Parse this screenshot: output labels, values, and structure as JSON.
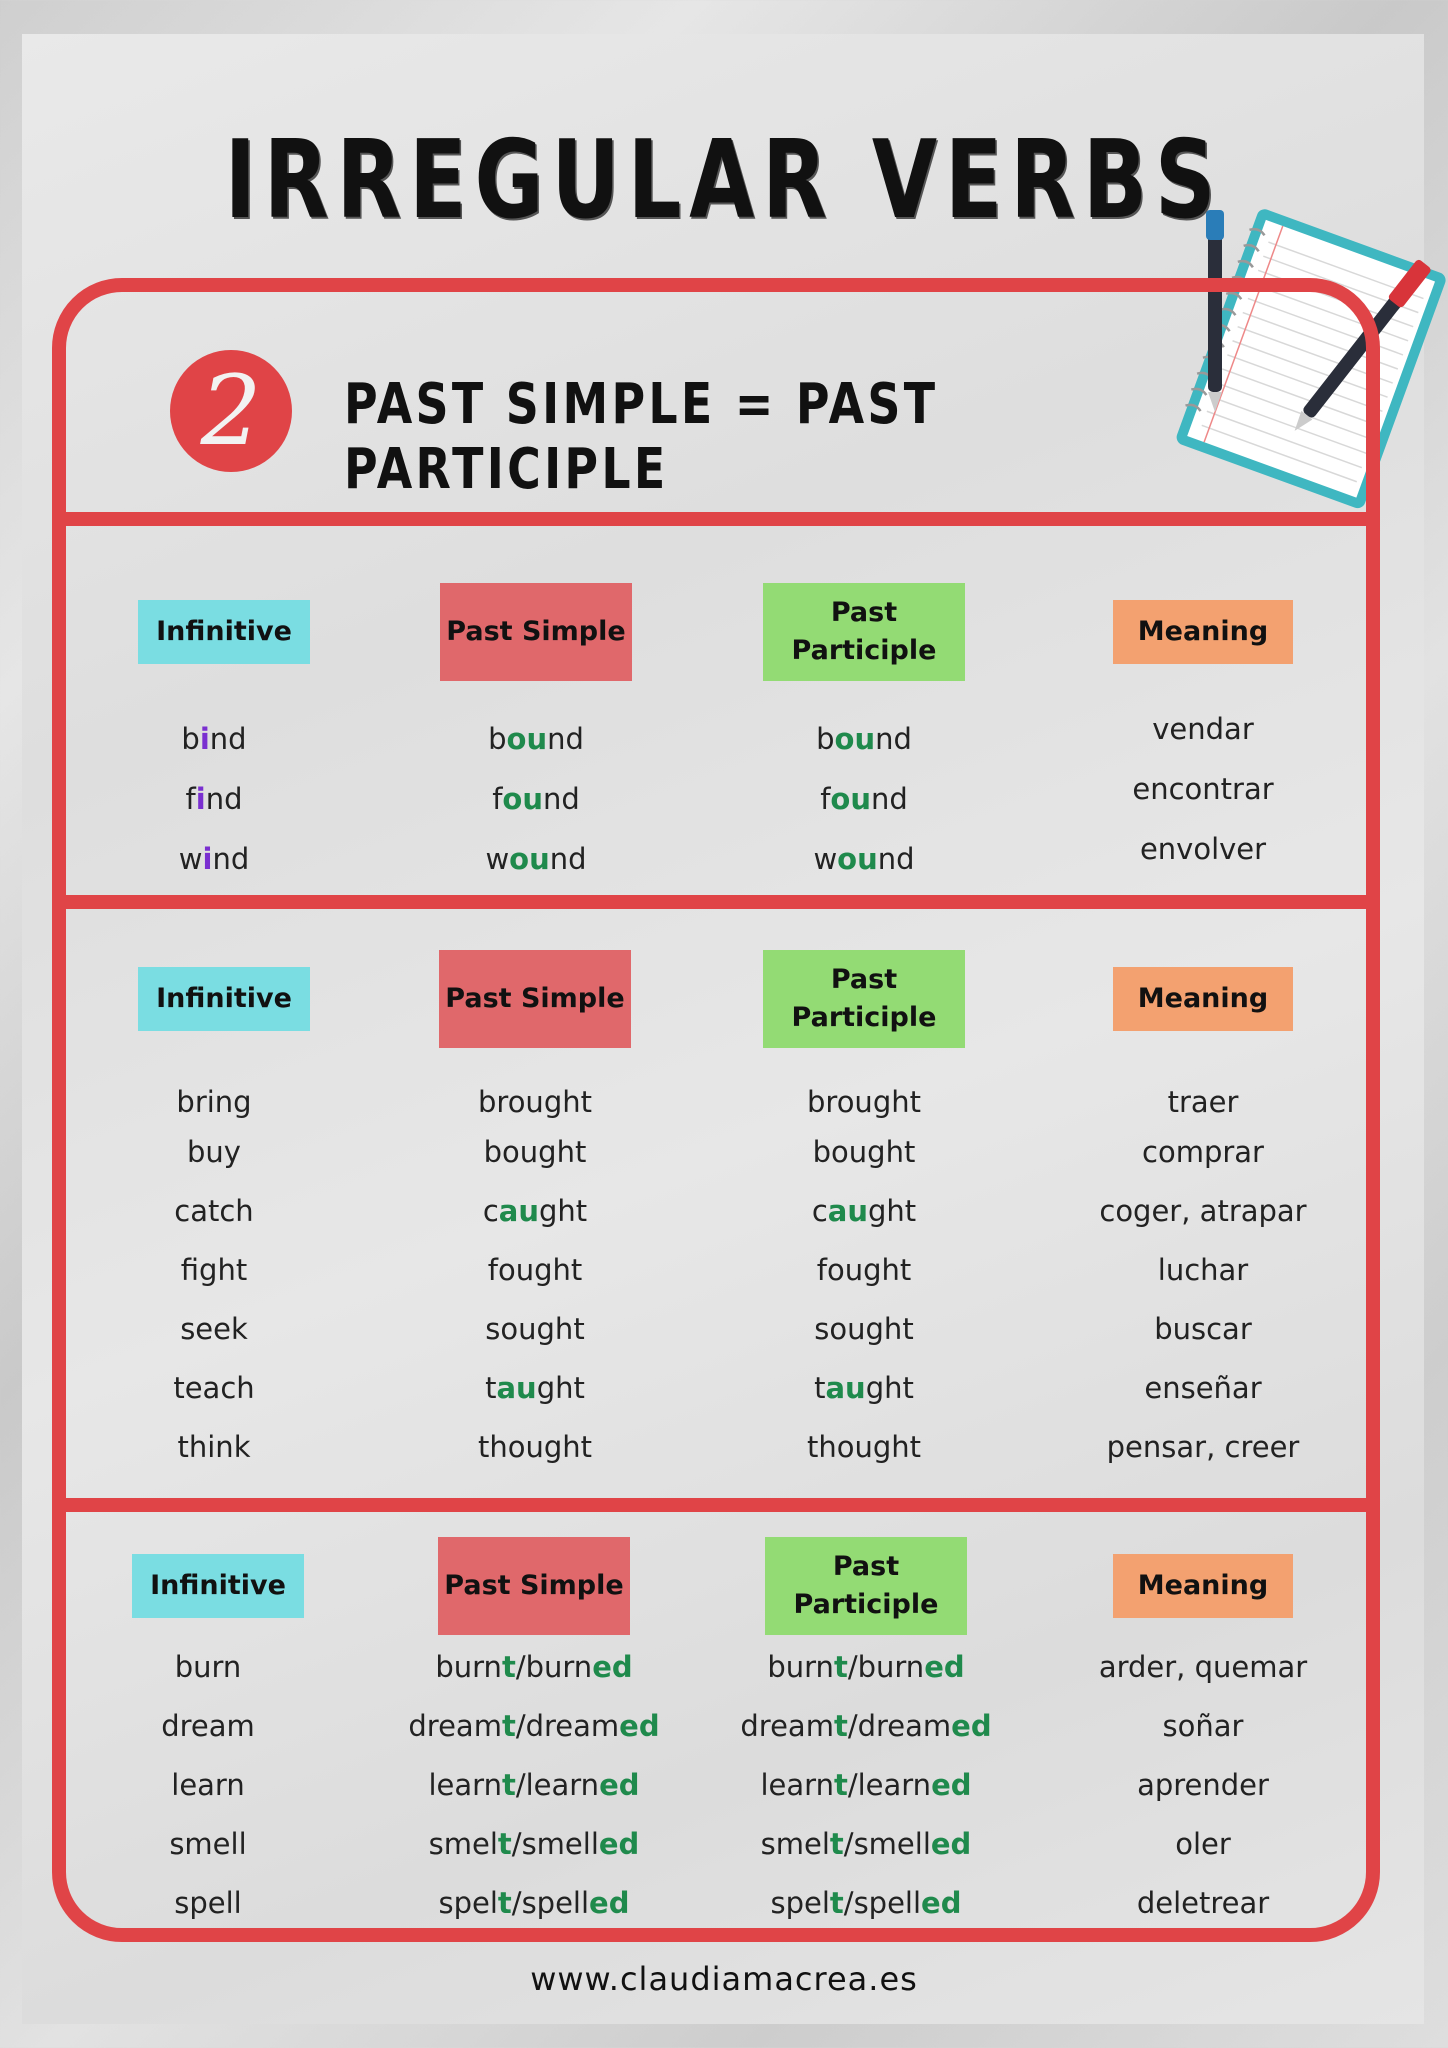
{
  "title": "IRREGULAR VERBS",
  "group": {
    "number": "2",
    "heading": "PAST SIMPLE = PAST PARTICIPLE"
  },
  "colors": {
    "frame": "#e04447",
    "infinitive_header": "#7adde2",
    "past_simple_header": "#e0686b",
    "past_participle_header": "#93db74",
    "meaning_header": "#f3a170",
    "highlight_green": "#1f8a4c",
    "highlight_purple": "#7a2fd0"
  },
  "headers": {
    "infinitive": "Infinitive",
    "past_simple": "Past Simple",
    "past_participle": "Past Participle",
    "meaning": "Meaning"
  },
  "sections": [
    {
      "rows": [
        {
          "infinitive": [
            [
              "b",
              ""
            ],
            [
              "i",
              "p"
            ],
            [
              "nd",
              ""
            ]
          ],
          "past_simple": [
            [
              "b",
              ""
            ],
            [
              "ou",
              "g"
            ],
            [
              "nd",
              ""
            ]
          ],
          "past_participle": [
            [
              "b",
              ""
            ],
            [
              "ou",
              "g"
            ],
            [
              "nd",
              ""
            ]
          ],
          "meaning": "vendar"
        },
        {
          "infinitive": [
            [
              "f",
              ""
            ],
            [
              "i",
              "p"
            ],
            [
              "nd",
              ""
            ]
          ],
          "past_simple": [
            [
              "f",
              ""
            ],
            [
              "ou",
              "g"
            ],
            [
              "nd",
              ""
            ]
          ],
          "past_participle": [
            [
              "f",
              ""
            ],
            [
              "ou",
              "g"
            ],
            [
              "nd",
              ""
            ]
          ],
          "meaning": "encontrar"
        },
        {
          "infinitive": [
            [
              "w",
              ""
            ],
            [
              "i",
              "p"
            ],
            [
              "nd",
              ""
            ]
          ],
          "past_simple": [
            [
              "w",
              ""
            ],
            [
              "ou",
              "g"
            ],
            [
              "nd",
              ""
            ]
          ],
          "past_participle": [
            [
              "w",
              ""
            ],
            [
              "ou",
              "g"
            ],
            [
              "nd",
              ""
            ]
          ],
          "meaning": "envolver"
        }
      ]
    },
    {
      "rows": [
        {
          "infinitive": [
            [
              "bring",
              ""
            ]
          ],
          "past_simple": [
            [
              "brought",
              ""
            ]
          ],
          "past_participle": [
            [
              "brought",
              ""
            ]
          ],
          "meaning": "traer"
        },
        {
          "infinitive": [
            [
              "buy",
              ""
            ]
          ],
          "past_simple": [
            [
              "bought",
              ""
            ]
          ],
          "past_participle": [
            [
              "bought",
              ""
            ]
          ],
          "meaning": "comprar"
        },
        {
          "infinitive": [
            [
              "catch",
              ""
            ]
          ],
          "past_simple": [
            [
              "c",
              ""
            ],
            [
              "au",
              "g"
            ],
            [
              "ght",
              ""
            ]
          ],
          "past_participle": [
            [
              "c",
              ""
            ],
            [
              "au",
              "g"
            ],
            [
              "ght",
              ""
            ]
          ],
          "meaning": "coger, atrapar"
        },
        {
          "infinitive": [
            [
              "fight",
              ""
            ]
          ],
          "past_simple": [
            [
              "fought",
              ""
            ]
          ],
          "past_participle": [
            [
              "fought",
              ""
            ]
          ],
          "meaning": "luchar"
        },
        {
          "infinitive": [
            [
              "seek",
              ""
            ]
          ],
          "past_simple": [
            [
              "sought",
              ""
            ]
          ],
          "past_participle": [
            [
              "sought",
              ""
            ]
          ],
          "meaning": "buscar"
        },
        {
          "infinitive": [
            [
              "teach",
              ""
            ]
          ],
          "past_simple": [
            [
              "t",
              ""
            ],
            [
              "au",
              "g"
            ],
            [
              "ght",
              ""
            ]
          ],
          "past_participle": [
            [
              "t",
              ""
            ],
            [
              "au",
              "g"
            ],
            [
              "ght",
              ""
            ]
          ],
          "meaning": "enseñar"
        },
        {
          "infinitive": [
            [
              "think",
              ""
            ]
          ],
          "past_simple": [
            [
              "thought",
              ""
            ]
          ],
          "past_participle": [
            [
              "thought",
              ""
            ]
          ],
          "meaning": "pensar, creer"
        }
      ]
    },
    {
      "rows": [
        {
          "infinitive": [
            [
              "burn",
              ""
            ]
          ],
          "past_simple": [
            [
              "burn",
              ""
            ],
            [
              "t",
              "g"
            ],
            [
              "/burn",
              ""
            ],
            [
              "ed",
              "g"
            ]
          ],
          "past_participle": [
            [
              "burn",
              ""
            ],
            [
              "t",
              "g"
            ],
            [
              "/burn",
              ""
            ],
            [
              "ed",
              "g"
            ]
          ],
          "meaning": "arder, quemar"
        },
        {
          "infinitive": [
            [
              "dream",
              ""
            ]
          ],
          "past_simple": [
            [
              "dream",
              ""
            ],
            [
              "t",
              "g"
            ],
            [
              "/dream",
              ""
            ],
            [
              "ed",
              "g"
            ]
          ],
          "past_participle": [
            [
              "dream",
              ""
            ],
            [
              "t",
              "g"
            ],
            [
              "/dream",
              ""
            ],
            [
              "ed",
              "g"
            ]
          ],
          "meaning": "soñar"
        },
        {
          "infinitive": [
            [
              "learn",
              ""
            ]
          ],
          "past_simple": [
            [
              "learn",
              ""
            ],
            [
              "t",
              "g"
            ],
            [
              "/learn",
              ""
            ],
            [
              "ed",
              "g"
            ]
          ],
          "past_participle": [
            [
              "learn",
              ""
            ],
            [
              "t",
              "g"
            ],
            [
              "/learn",
              ""
            ],
            [
              "ed",
              "g"
            ]
          ],
          "meaning": "aprender"
        },
        {
          "infinitive": [
            [
              "smell",
              ""
            ]
          ],
          "past_simple": [
            [
              "smel",
              ""
            ],
            [
              "t",
              "g"
            ],
            [
              "/smell",
              ""
            ],
            [
              "ed",
              "g"
            ]
          ],
          "past_participle": [
            [
              "smel",
              ""
            ],
            [
              "t",
              "g"
            ],
            [
              "/smell",
              ""
            ],
            [
              "ed",
              "g"
            ]
          ],
          "meaning": "oler"
        },
        {
          "infinitive": [
            [
              "spell",
              ""
            ]
          ],
          "past_simple": [
            [
              "spel",
              ""
            ],
            [
              "t",
              "g"
            ],
            [
              "/spell",
              ""
            ],
            [
              "ed",
              "g"
            ]
          ],
          "past_participle": [
            [
              "spel",
              ""
            ],
            [
              "t",
              "g"
            ],
            [
              "/spell",
              ""
            ],
            [
              "ed",
              "g"
            ]
          ],
          "meaning": "deletrear"
        }
      ]
    }
  ],
  "footer": "www.claudiamacrea.es"
}
